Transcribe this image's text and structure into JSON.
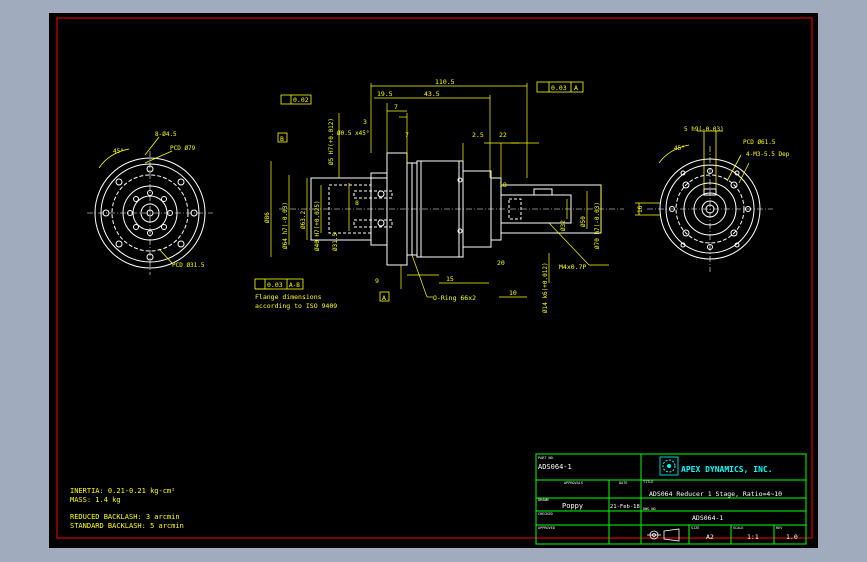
{
  "colors": {
    "background": "#000000",
    "border": "#ff0000",
    "geometry": "#ffffff",
    "dimensions": "#ffff00",
    "titleblock": "#00ff00",
    "cyan": "#00ffff",
    "app_bg": "#a0acbd"
  },
  "drawing": {
    "top_dims": {
      "overall": "110.5",
      "d1": "19.5",
      "d2": "43.5",
      "d3": "7",
      "d4": "3",
      "d5": "2.5",
      "d6": "22",
      "d7": "18",
      "d8": "7",
      "d9": "8",
      "d10": "15",
      "d11": "9",
      "d12": "10",
      "d13": "20"
    },
    "gdt": {
      "flatness": "0.02",
      "parallel": "0.03",
      "parallel_ref": "A",
      "runout": "0.03",
      "runout_ref": "A-B",
      "datum_a": "A",
      "datum_b": "B"
    },
    "left_view": {
      "pcd_top": "PCD Ø79",
      "holes": "8-Ø4.5",
      "pcd_bottom": "PCD Ø31.5",
      "angle": "45°"
    },
    "side_view": {
      "chamfer": "Ø0.5 x45°",
      "dia_86": "Ø86",
      "dia_64": "Ø64 h7(-0.03)",
      "dia_63": "Ø63.2",
      "dia_40": "Ø40 H7(+0.025)",
      "dia_31": "Ø31.5",
      "dia_5": "Ø5 H7(+0.012)",
      "dia_32": "Ø32",
      "dia_50": "Ø50",
      "dia_70": "Ø70 h7(-0.03)",
      "dia_14": "Ø14 k6(+0.012)",
      "thread": "M4x0.7P",
      "oring": "O-Ring 66x2",
      "flange_note_1": "Flange dimensions",
      "flange_note_2": "according to ISO 9409"
    },
    "right_view": {
      "pcd": "PCD Ø61.5",
      "holes": "4-M3-5.5 Dep",
      "key": "5 h9(-0.03)",
      "angle": "45°",
      "dim_16": "16"
    },
    "notes": {
      "inertia": "INERTIA: 0.21-0.21 kg-cm²",
      "mass": "MASS: 1.4 kg",
      "backlash_reduced": "REDUCED BACKLASH: 3 arcmin",
      "backlash_standard": "STANDARD BACKLASH: 5 arcmin"
    },
    "title_block": {
      "part_no_label": "PART NO.",
      "part_no": "ADS064-1",
      "company": "APEX DYNAMICS, INC.",
      "approvals_label": "APPROVALS",
      "date_label": "DATE",
      "title_label": "TITLE",
      "title": "ADS064 Reducer 1 Stage, Ratio=4~10",
      "drawn_label": "DRAWN",
      "drawn_by": "Poppy",
      "drawn_date": "21-Feb-18",
      "dwg_no_label": "DWG NO",
      "dwg_no": "ADS064-1",
      "checked_label": "CHECKED",
      "approved_label": "APPROVED",
      "size_label": "SIZE",
      "size": "A2",
      "scale_label": "SCALE",
      "scale": "1:1",
      "rev_label": "REV",
      "rev": "1.0"
    }
  }
}
